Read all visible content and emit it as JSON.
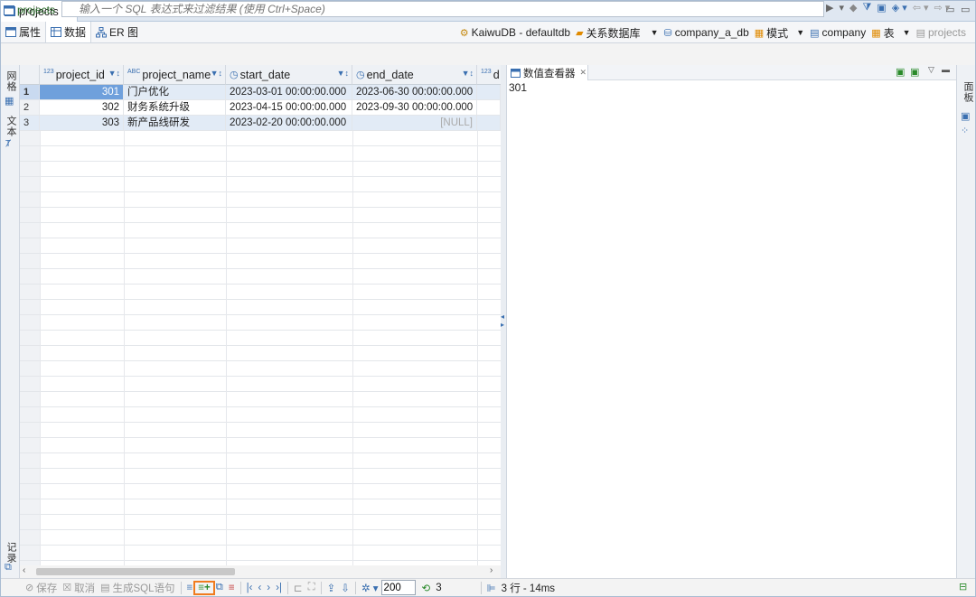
{
  "editor_tab": {
    "title": "projects"
  },
  "subtabs": [
    {
      "label": "属性"
    },
    {
      "label": "数据"
    },
    {
      "label": "ER 图"
    }
  ],
  "breadcrumbs": {
    "connection": "KaiwuDB - defaultdb",
    "db_type": "关系数据库",
    "database": "company_a_db",
    "schema_label": "模式",
    "schema": "company",
    "tables_label": "表",
    "table": "projects"
  },
  "filter": {
    "label": "projects",
    "placeholder": "输入一个 SQL 表达式来过滤结果 (使用 Ctrl+Space)"
  },
  "left_rail": {
    "grid": "网格",
    "text": "文本",
    "record": "记录"
  },
  "right_rail": {
    "panels": "面板"
  },
  "columns": [
    {
      "name": "project_id",
      "type_tag": "123"
    },
    {
      "name": "project_name",
      "type_tag": "ABC"
    },
    {
      "name": "start_date",
      "type_tag": ""
    },
    {
      "name": "end_date",
      "type_tag": ""
    },
    {
      "name": "d",
      "type_tag": "123"
    }
  ],
  "rows": [
    {
      "no": "1",
      "project_id": "301",
      "project_name": "门户优化",
      "start_date": "2023-03-01 00:00:00.000",
      "end_date": "2023-06-30 00:00:00.000"
    },
    {
      "no": "2",
      "project_id": "302",
      "project_name": "财务系统升级",
      "start_date": "2023-04-15 00:00:00.000",
      "end_date": "2023-09-30 00:00:00.000"
    },
    {
      "no": "3",
      "project_id": "303",
      "project_name": "新产品线研发",
      "start_date": "2023-02-20 00:00:00.000",
      "end_date": "[NULL]"
    }
  ],
  "value_viewer": {
    "title": "数值查看器",
    "value": "301"
  },
  "bottom": {
    "save": "保存",
    "cancel": "取消",
    "gen_sql": "生成SQL语句",
    "fetch_size": "200",
    "row_count": "3",
    "status": "3 行 - 14ms"
  },
  "colors": {
    "accent": "#3a6fb0",
    "highlight": "#f07b1e",
    "selected_cell": "#6fa0dc"
  }
}
